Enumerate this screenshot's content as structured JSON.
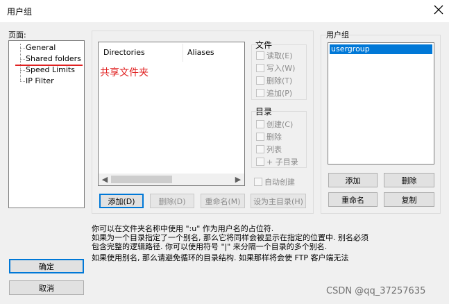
{
  "window": {
    "title": "用户组",
    "close_icon": "close-icon"
  },
  "sidebar": {
    "label": "页面:",
    "items": [
      {
        "label": "General"
      },
      {
        "label": "Shared folders"
      },
      {
        "label": "Speed Limits"
      },
      {
        "label": "IP Filter"
      }
    ],
    "annotation_color": "#e02020"
  },
  "folders": {
    "columns": [
      "Directories",
      "Aliases"
    ],
    "annotation": "共享文件夹",
    "buttons": {
      "add": "添加(D)",
      "remove": "删除(D)",
      "rename": "重命名(M)",
      "set_home": "设为主目录(H)"
    }
  },
  "files": {
    "title": "文件",
    "options": [
      "读取(E)",
      "写入(W)",
      "删除(T)",
      "追加(P)"
    ]
  },
  "dirs": {
    "title": "目录",
    "options": [
      "创建(C)",
      "删除",
      "列表",
      "+ 子目录"
    ]
  },
  "auto_create": "自动创建",
  "groups": {
    "label": "用户组",
    "items": [
      "usergroup"
    ],
    "selected_color": "#0078d7",
    "buttons": {
      "add": "添加",
      "remove": "删除",
      "rename": "重命名",
      "copy": "复制"
    }
  },
  "info": {
    "line1": "你可以在文件夹名称中使用 \":u\" 作为用户名的占位符.",
    "line2": "如果为一个目录指定了一个别名, 那么它将同样会被显示在指定的位置中. 别名必须",
    "line3": "包含完整的逻辑路径. 你可以使用符号 \"|\" 来分隔一个目录的多个别名.",
    "line4": "如果使用别名, 那么请避免循环的目录结构. 如果那样将会使 FTP 客户端无法"
  },
  "footer": {
    "ok": "确定",
    "cancel": "取消",
    "watermark": "CSDN @qq_37257635"
  }
}
